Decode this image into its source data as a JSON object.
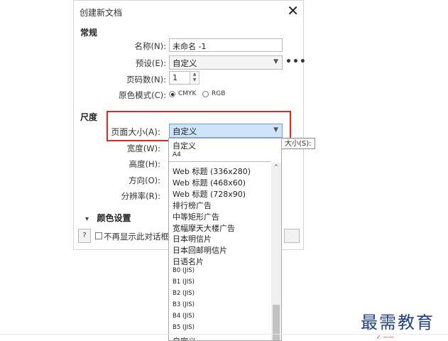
{
  "dialog": {
    "title": "创建新文档",
    "close_symbol": "✕",
    "general": {
      "heading": "常规",
      "name_label": "名称(N):",
      "name_value": "未命名 -1",
      "preset_label": "预设(E):",
      "preset_value": "自定义",
      "more_symbol": "•••",
      "pages_label": "页码数(N):",
      "pages_value": "1",
      "color_mode_label": "原色模式(C):",
      "color_mode_options": [
        "CMYK",
        "RGB"
      ],
      "color_mode_selected": "CMYK"
    },
    "size": {
      "heading": "尺度",
      "page_size_label": "页面大小(A):",
      "page_size_value": "自定义",
      "width_label": "宽度(W):",
      "height_label": "高度(H):",
      "orientation_label": "方向(O):",
      "resolution_label": "分辨率(R):"
    },
    "color_settings": {
      "collapse_symbol": "▾",
      "label": "颜色设置"
    },
    "footer": {
      "help_symbol": "?",
      "dont_show_label": "不再显示此对话框"
    }
  },
  "tooltip": "大小(S):",
  "dropdown": {
    "top_items": [
      "自定义",
      "A4"
    ],
    "items": [
      {
        "text": "Web 标题 (336x280)",
        "small": false
      },
      {
        "text": "Web 标题 (468x60)",
        "small": false
      },
      {
        "text": "Web 标题 (728x90)",
        "small": false
      },
      {
        "text": "排行榜广告",
        "small": false
      },
      {
        "text": "中等矩形广告",
        "small": false
      },
      {
        "text": "宽幅摩天大楼广告",
        "small": false
      },
      {
        "text": "日本明信片",
        "small": false
      },
      {
        "text": "日本回邮明信片",
        "small": false
      },
      {
        "text": "日语名片",
        "small": false
      },
      {
        "text": "B0 (JIS)",
        "small": true
      },
      {
        "text": "B1 (JIS)",
        "small": true
      },
      {
        "text": "B2 (JIS)",
        "small": true
      },
      {
        "text": "B3 (JIS)",
        "small": true
      },
      {
        "text": "B4 (JIS)",
        "small": true
      },
      {
        "text": "B5 (JIS)",
        "small": true
      },
      {
        "text": "自定义",
        "small": false
      }
    ]
  },
  "watermark": "最需教育",
  "colors": {
    "highlight_box": "#e8241f",
    "selected_field": "#cfe3fb",
    "watermark": "#1f3f8f"
  }
}
